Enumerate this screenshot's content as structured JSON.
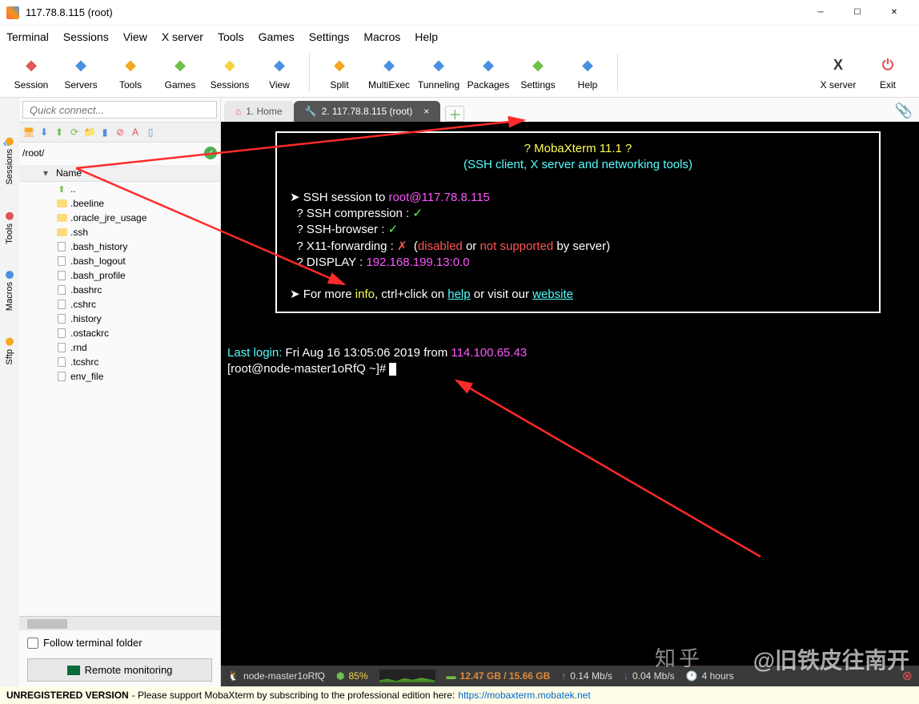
{
  "window": {
    "title": "117.78.8.115 (root)"
  },
  "menu": [
    "Terminal",
    "Sessions",
    "View",
    "X server",
    "Tools",
    "Games",
    "Settings",
    "Macros",
    "Help"
  ],
  "toolbar": [
    {
      "label": "Session",
      "color": "#e05555"
    },
    {
      "label": "Servers",
      "color": "#4a90e2"
    },
    {
      "label": "Tools",
      "color": "#f5a623"
    },
    {
      "label": "Games",
      "color": "#6fbf4a"
    },
    {
      "label": "Sessions",
      "color": "#f5d442"
    },
    {
      "label": "View",
      "color": "#4a90e2"
    },
    {
      "label": "Split",
      "color": "#f5a623"
    },
    {
      "label": "MultiExec",
      "color": "#4a90e2"
    },
    {
      "label": "Tunneling",
      "color": "#4a90e2"
    },
    {
      "label": "Packages",
      "color": "#4a90e2"
    },
    {
      "label": "Settings",
      "color": "#6fbf4a"
    },
    {
      "label": "Help",
      "color": "#4a90e2"
    }
  ],
  "toolbar_right": [
    {
      "label": "X server",
      "color": "#333"
    },
    {
      "label": "Exit",
      "color": "#e05555"
    }
  ],
  "quick_placeholder": "Quick connect...",
  "sidetabs": [
    {
      "label": "Sessions",
      "color": "#f5a623"
    },
    {
      "label": "Tools",
      "color": "#e05555"
    },
    {
      "label": "Macros",
      "color": "#4a90e2"
    },
    {
      "label": "Sftp",
      "color": "#f5a623"
    }
  ],
  "path": "/root/",
  "files_header": "Name",
  "files": [
    {
      "name": "..",
      "type": "up"
    },
    {
      "name": ".beeline",
      "type": "folder"
    },
    {
      "name": ".oracle_jre_usage",
      "type": "folder"
    },
    {
      "name": ".ssh",
      "type": "folder"
    },
    {
      "name": ".bash_history",
      "type": "file"
    },
    {
      "name": ".bash_logout",
      "type": "file"
    },
    {
      "name": ".bash_profile",
      "type": "file"
    },
    {
      "name": ".bashrc",
      "type": "file"
    },
    {
      "name": ".cshrc",
      "type": "file"
    },
    {
      "name": ".history",
      "type": "file"
    },
    {
      "name": ".ostackrc",
      "type": "file"
    },
    {
      "name": ".rnd",
      "type": "file"
    },
    {
      "name": ".tcshrc",
      "type": "file"
    },
    {
      "name": "env_file",
      "type": "file"
    }
  ],
  "follow_label": "Follow terminal folder",
  "remote_monitoring": "Remote monitoring",
  "tabs": [
    {
      "label": "1. Home",
      "active": false
    },
    {
      "label": "2. 117.78.8.115 (root)",
      "active": true
    }
  ],
  "term": {
    "banner_title": "? MobaXterm 11.1 ?",
    "banner_sub": "(SSH client, X server and networking tools)",
    "ssh_to_pre": "SSH session to ",
    "ssh_to_host": "root@117.78.8.115",
    "comp": "? SSH compression :",
    "browser": "? SSH-browser     :",
    "x11": "? X11-forwarding  :",
    "x11_msg1": "(",
    "x11_msg2": "disabled",
    "x11_msg3": " or ",
    "x11_msg4": "not supported",
    "x11_msg5": " by server)",
    "display": "? DISPLAY         :",
    "display_val": "192.168.199.13:0.0",
    "more1": "For more ",
    "more_info": "info",
    "more2": ", ctrl+click on ",
    "more_help": "help",
    "more3": " or visit our ",
    "more_web": "website",
    "last_pre": "Last login:",
    "last_msg": " Fri Aug 16 13:05:06 2019 from ",
    "last_ip": "114.100.65.43",
    "prompt": "[root@node-master1oRfQ ~]# "
  },
  "status": {
    "host": "node-master1oRfQ",
    "cpu": "85%",
    "mem": "12.47 GB / 15.66 GB",
    "up": "0.14 Mb/s",
    "down": "0.04 Mb/s",
    "time": "4 hours"
  },
  "footer": {
    "unreg": "UNREGISTERED VERSION",
    "msg": " -  Please support MobaXterm by subscribing to the professional edition here: ",
    "link": "https://mobaxterm.mobatek.net"
  },
  "watermark": "@旧铁皮往南开"
}
